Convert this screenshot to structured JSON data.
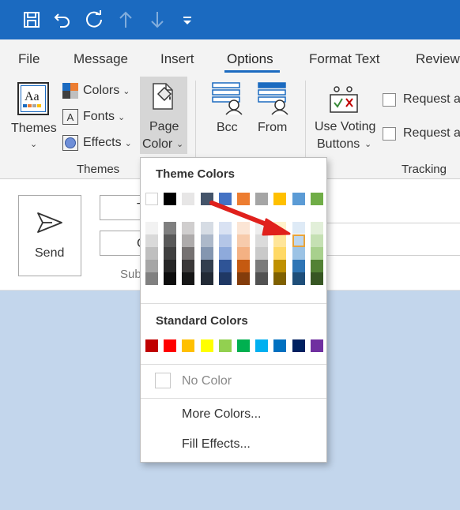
{
  "quick_access": {
    "icons": [
      "save-icon",
      "undo-icon",
      "redo-icon",
      "up-arrow-icon",
      "down-arrow-icon",
      "customize-qat-icon"
    ]
  },
  "tabs": [
    "File",
    "Message",
    "Insert",
    "Options",
    "Format Text",
    "Review"
  ],
  "active_tab": "Options",
  "ribbon": {
    "themes_group": {
      "themes_label": "Themes",
      "themes_icon_text": "Aa",
      "colors_label": "Colors",
      "fonts_label": "Fonts",
      "effects_label": "Effects",
      "group_label": "Themes"
    },
    "page_color": {
      "line1": "Page",
      "line2": "Color"
    },
    "show_fields": {
      "bcc_label": "Bcc",
      "from_label": "From"
    },
    "tracking": {
      "voting_line1": "Use Voting",
      "voting_line2": "Buttons",
      "request_1": "Request a",
      "request_2": "Request a",
      "group_label": "Tracking"
    }
  },
  "compose": {
    "send_label": "Send",
    "to_partial": "T",
    "cc_partial": "C",
    "subject_partial": "Sub"
  },
  "page_color_menu": {
    "theme_colors_header": "Theme Colors",
    "standard_colors_header": "Standard Colors",
    "no_color_label": "No Color",
    "more_colors_label": "More Colors...",
    "fill_effects_label": "Fill Effects...",
    "selected_swatch": "theme-column-9-row-2",
    "theme_columns": [
      [
        "#ffffff",
        "#f2f2f2",
        "#d9d9d9",
        "#bfbfbf",
        "#a6a6a6",
        "#808080"
      ],
      [
        "#000000",
        "#7f7f7f",
        "#595959",
        "#404040",
        "#262626",
        "#0d0d0d"
      ],
      [
        "#e7e6e6",
        "#d0cece",
        "#aeabab",
        "#757171",
        "#3a3838",
        "#161616"
      ],
      [
        "#44546a",
        "#d6dce4",
        "#adb9ca",
        "#8496b0",
        "#333f4f",
        "#222a35"
      ],
      [
        "#4472c4",
        "#d9e2f3",
        "#b4c6e7",
        "#8eaadb",
        "#2f5496",
        "#1f3864"
      ],
      [
        "#ed7d31",
        "#fbe5d5",
        "#f7cbac",
        "#f4b183",
        "#c55a11",
        "#833c0b"
      ],
      [
        "#a5a5a5",
        "#ededed",
        "#dbdbdb",
        "#c9c9c9",
        "#7b7b7b",
        "#525252"
      ],
      [
        "#ffc000",
        "#fff2cc",
        "#ffe599",
        "#ffd966",
        "#bf9000",
        "#7f6000"
      ],
      [
        "#5b9bd5",
        "#deeaf6",
        "#bdd6ee",
        "#9cc3e5",
        "#2e75b5",
        "#1e4e79"
      ],
      [
        "#70ad47",
        "#e2efd9",
        "#c5e0b3",
        "#a8d08d",
        "#538135",
        "#375623"
      ]
    ],
    "standard_colors": [
      "#c00000",
      "#ff0000",
      "#ffc000",
      "#ffff00",
      "#92d050",
      "#00b050",
      "#00b0f0",
      "#0070c0",
      "#002060",
      "#7030a0"
    ]
  },
  "annotation": {
    "arrow_color": "#e0201c"
  }
}
